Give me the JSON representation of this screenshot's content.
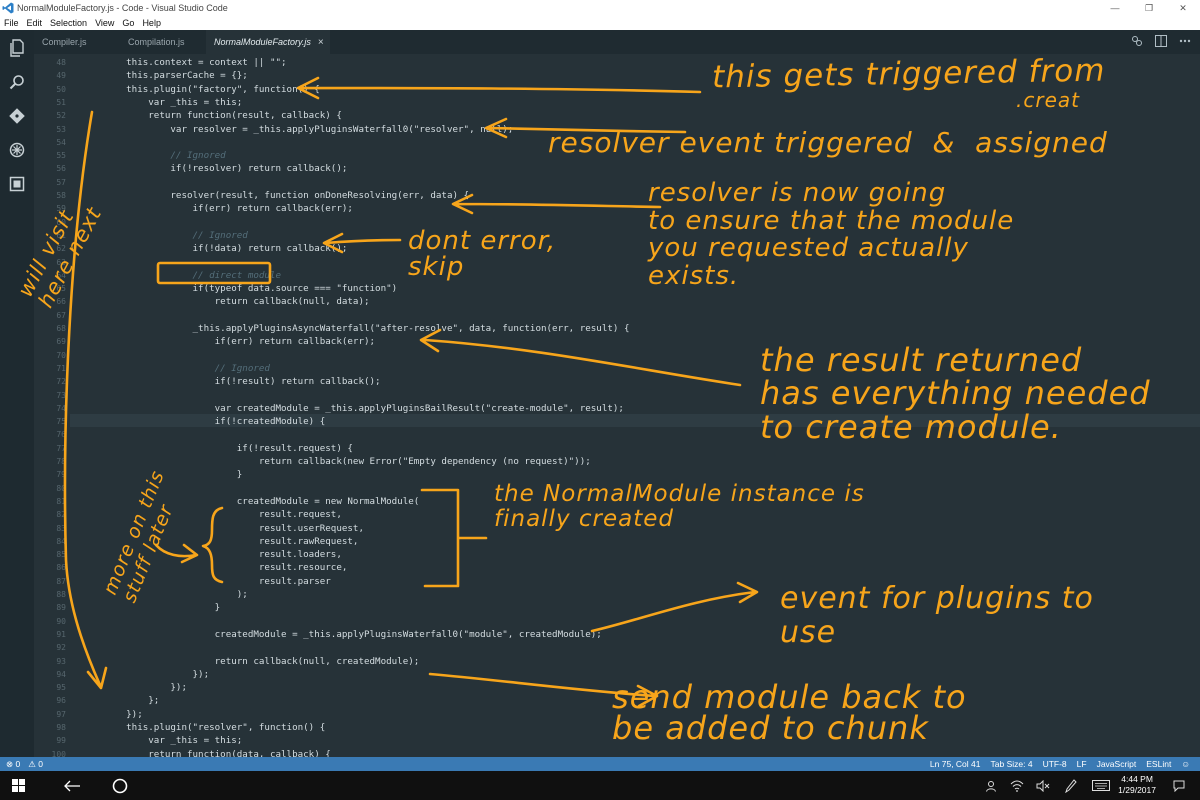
{
  "window": {
    "title": "NormalModuleFactory.js - Code - Visual Studio Code",
    "minimize": "—",
    "restore": "❐",
    "close": "✕"
  },
  "menu": [
    "File",
    "Edit",
    "Selection",
    "View",
    "Go",
    "Help"
  ],
  "activity_icons": [
    "files-icon",
    "search-icon",
    "git-icon",
    "debug-icon",
    "extensions-icon"
  ],
  "tabs": [
    {
      "label": "Compiler.js",
      "active": false
    },
    {
      "label": "Compilation.js",
      "active": false
    },
    {
      "label": "NormalModuleFactory.js",
      "active": true,
      "close": "×"
    }
  ],
  "code": {
    "first_line": 48,
    "current_line": 75,
    "lines": [
      "    this.context = context || \"\";",
      "    this.parserCache = {};",
      "    this.plugin(\"factory\", function() {",
      "        var _this = this;",
      "        return function(result, callback) {",
      "            var resolver = _this.applyPluginsWaterfall0(\"resolver\", null);",
      "",
      "            // Ignored",
      "            if(!resolver) return callback();",
      "",
      "            resolver(result, function onDoneResolving(err, data) {",
      "                if(err) return callback(err);",
      "",
      "                // Ignored",
      "                if(!data) return callback();",
      "",
      "                // direct module",
      "                if(typeof data.source === \"function\")",
      "                    return callback(null, data);",
      "",
      "                _this.applyPluginsAsyncWaterfall(\"after-resolve\", data, function(err, result) {",
      "                    if(err) return callback(err);",
      "",
      "                    // Ignored",
      "                    if(!result) return callback();",
      "",
      "                    var createdModule = _this.applyPluginsBailResult(\"create-module\", result);",
      "                    if(!createdModule) {",
      "",
      "                        if(!result.request) {",
      "                            return callback(new Error(\"Empty dependency (no request)\"));",
      "                        }",
      "",
      "                        createdModule = new NormalModule(",
      "                            result.request,",
      "                            result.userRequest,",
      "                            result.rawRequest,",
      "                            result.loaders,",
      "                            result.resource,",
      "                            result.parser",
      "                        );",
      "                    }",
      "",
      "                    createdModule = _this.applyPluginsWaterfall0(\"module\", createdModule);",
      "",
      "                    return callback(null, createdModule);",
      "                });",
      "            });",
      "        };",
      "    });",
      "    this.plugin(\"resolver\", function() {",
      "        var _this = this;",
      "        return function(data, callback) {"
    ]
  },
  "annotations": {
    "factory_trigger": "this gets triggered from",
    "factory_trigger_2": ".creat",
    "resolver_event": "resolver event triggered  &  assigned",
    "resolver_check": "resolver is now going\nto ensure that the module\nyou requested actually\nexists.",
    "dont_error": "dont error,\nskip",
    "result_returned": "the result returned\nhas everything needed\nto create module.",
    "normal_module": "the NormalModule instance is\nfinally created",
    "plugins_event": "event for plugins to\nuse",
    "send_back": "send module back to\nbe added to chunk",
    "will_visit": "will visit\nhere next",
    "more_later": "more on this\nstuff later",
    "color": "#f7a51b"
  },
  "status": {
    "errors": "⊗ 0",
    "warnings": "⚠ 0",
    "position": "Ln 75, Col 41",
    "tab_size": "Tab Size: 4",
    "encoding": "UTF-8",
    "eol": "LF",
    "language": "JavaScript",
    "linter": "ESLint",
    "accent": "#3a7ab4"
  },
  "taskbar": {
    "time": "4:44 PM",
    "date": "1/29/2017"
  }
}
